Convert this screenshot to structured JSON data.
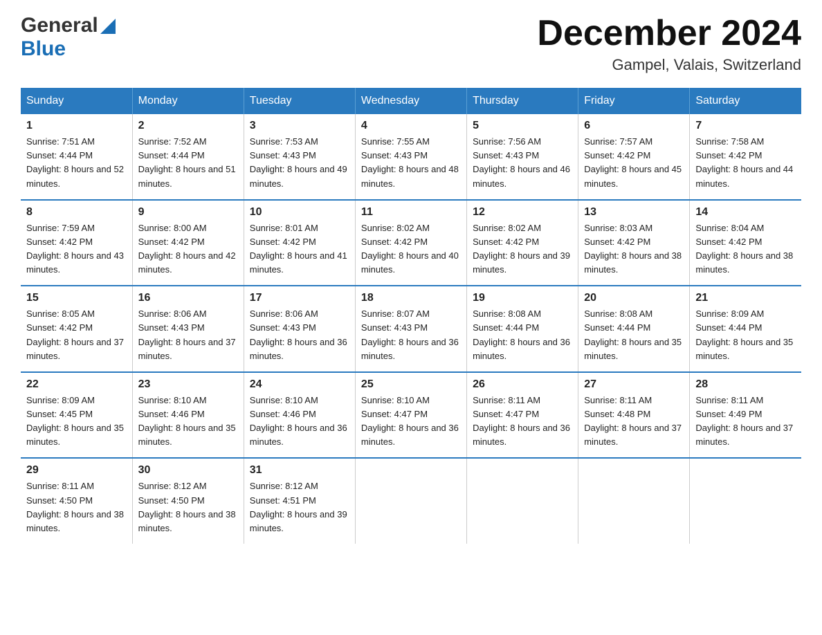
{
  "header": {
    "logo": {
      "line1": "General",
      "line2": "Blue"
    },
    "title": "December 2024",
    "location": "Gampel, Valais, Switzerland"
  },
  "calendar": {
    "headers": [
      "Sunday",
      "Monday",
      "Tuesday",
      "Wednesday",
      "Thursday",
      "Friday",
      "Saturday"
    ],
    "weeks": [
      [
        {
          "day": "1",
          "sunrise": "7:51 AM",
          "sunset": "4:44 PM",
          "daylight": "8 hours and 52 minutes."
        },
        {
          "day": "2",
          "sunrise": "7:52 AM",
          "sunset": "4:44 PM",
          "daylight": "8 hours and 51 minutes."
        },
        {
          "day": "3",
          "sunrise": "7:53 AM",
          "sunset": "4:43 PM",
          "daylight": "8 hours and 49 minutes."
        },
        {
          "day": "4",
          "sunrise": "7:55 AM",
          "sunset": "4:43 PM",
          "daylight": "8 hours and 48 minutes."
        },
        {
          "day": "5",
          "sunrise": "7:56 AM",
          "sunset": "4:43 PM",
          "daylight": "8 hours and 46 minutes."
        },
        {
          "day": "6",
          "sunrise": "7:57 AM",
          "sunset": "4:42 PM",
          "daylight": "8 hours and 45 minutes."
        },
        {
          "day": "7",
          "sunrise": "7:58 AM",
          "sunset": "4:42 PM",
          "daylight": "8 hours and 44 minutes."
        }
      ],
      [
        {
          "day": "8",
          "sunrise": "7:59 AM",
          "sunset": "4:42 PM",
          "daylight": "8 hours and 43 minutes."
        },
        {
          "day": "9",
          "sunrise": "8:00 AM",
          "sunset": "4:42 PM",
          "daylight": "8 hours and 42 minutes."
        },
        {
          "day": "10",
          "sunrise": "8:01 AM",
          "sunset": "4:42 PM",
          "daylight": "8 hours and 41 minutes."
        },
        {
          "day": "11",
          "sunrise": "8:02 AM",
          "sunset": "4:42 PM",
          "daylight": "8 hours and 40 minutes."
        },
        {
          "day": "12",
          "sunrise": "8:02 AM",
          "sunset": "4:42 PM",
          "daylight": "8 hours and 39 minutes."
        },
        {
          "day": "13",
          "sunrise": "8:03 AM",
          "sunset": "4:42 PM",
          "daylight": "8 hours and 38 minutes."
        },
        {
          "day": "14",
          "sunrise": "8:04 AM",
          "sunset": "4:42 PM",
          "daylight": "8 hours and 38 minutes."
        }
      ],
      [
        {
          "day": "15",
          "sunrise": "8:05 AM",
          "sunset": "4:42 PM",
          "daylight": "8 hours and 37 minutes."
        },
        {
          "day": "16",
          "sunrise": "8:06 AM",
          "sunset": "4:43 PM",
          "daylight": "8 hours and 37 minutes."
        },
        {
          "day": "17",
          "sunrise": "8:06 AM",
          "sunset": "4:43 PM",
          "daylight": "8 hours and 36 minutes."
        },
        {
          "day": "18",
          "sunrise": "8:07 AM",
          "sunset": "4:43 PM",
          "daylight": "8 hours and 36 minutes."
        },
        {
          "day": "19",
          "sunrise": "8:08 AM",
          "sunset": "4:44 PM",
          "daylight": "8 hours and 36 minutes."
        },
        {
          "day": "20",
          "sunrise": "8:08 AM",
          "sunset": "4:44 PM",
          "daylight": "8 hours and 35 minutes."
        },
        {
          "day": "21",
          "sunrise": "8:09 AM",
          "sunset": "4:44 PM",
          "daylight": "8 hours and 35 minutes."
        }
      ],
      [
        {
          "day": "22",
          "sunrise": "8:09 AM",
          "sunset": "4:45 PM",
          "daylight": "8 hours and 35 minutes."
        },
        {
          "day": "23",
          "sunrise": "8:10 AM",
          "sunset": "4:46 PM",
          "daylight": "8 hours and 35 minutes."
        },
        {
          "day": "24",
          "sunrise": "8:10 AM",
          "sunset": "4:46 PM",
          "daylight": "8 hours and 36 minutes."
        },
        {
          "day": "25",
          "sunrise": "8:10 AM",
          "sunset": "4:47 PM",
          "daylight": "8 hours and 36 minutes."
        },
        {
          "day": "26",
          "sunrise": "8:11 AM",
          "sunset": "4:47 PM",
          "daylight": "8 hours and 36 minutes."
        },
        {
          "day": "27",
          "sunrise": "8:11 AM",
          "sunset": "4:48 PM",
          "daylight": "8 hours and 37 minutes."
        },
        {
          "day": "28",
          "sunrise": "8:11 AM",
          "sunset": "4:49 PM",
          "daylight": "8 hours and 37 minutes."
        }
      ],
      [
        {
          "day": "29",
          "sunrise": "8:11 AM",
          "sunset": "4:50 PM",
          "daylight": "8 hours and 38 minutes."
        },
        {
          "day": "30",
          "sunrise": "8:12 AM",
          "sunset": "4:50 PM",
          "daylight": "8 hours and 38 minutes."
        },
        {
          "day": "31",
          "sunrise": "8:12 AM",
          "sunset": "4:51 PM",
          "daylight": "8 hours and 39 minutes."
        },
        null,
        null,
        null,
        null
      ]
    ]
  }
}
